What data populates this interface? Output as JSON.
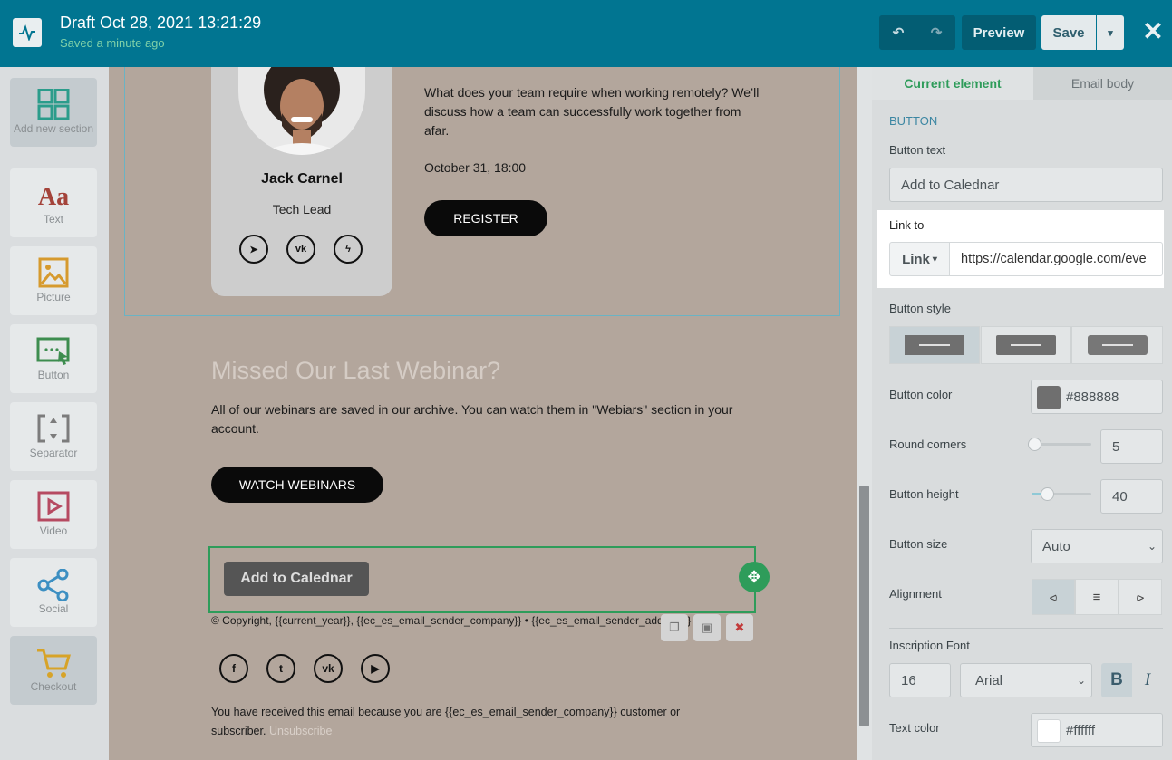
{
  "header": {
    "title": "Draft Oct 28, 2021 13:21:29",
    "subtitle": "Saved a minute ago",
    "undo_icon": "↶",
    "redo_icon": "↷",
    "preview_label": "Preview",
    "save_label": "Save",
    "save_caret": "▾",
    "close_icon": "✕"
  },
  "toolbar": {
    "items": [
      {
        "label": "Add new section",
        "icon": "grid-icon"
      },
      {
        "label": "Text",
        "icon": "text-icon"
      },
      {
        "label": "Picture",
        "icon": "picture-icon"
      },
      {
        "label": "Button",
        "icon": "button-icon"
      },
      {
        "label": "Separator",
        "icon": "separator-icon"
      },
      {
        "label": "Video",
        "icon": "video-icon"
      },
      {
        "label": "Social",
        "icon": "social-icon"
      },
      {
        "label": "Checkout",
        "icon": "cart-icon"
      }
    ]
  },
  "canvas": {
    "speaker": {
      "name": "Jack Carnel",
      "role": "Tech Lead",
      "socials": [
        "telegram-icon",
        "vk-icon",
        "messenger-icon"
      ],
      "social_glyphs": [
        "➤",
        "vk",
        "ϟ"
      ]
    },
    "event": {
      "description": "What does your team require when working remotely? We’ll discuss how a team can successfully work together from afar.",
      "date": "October 31, 18:00",
      "register_label": "REGISTER"
    },
    "missed": {
      "heading": "Missed Our Last Webinar?",
      "text": "All of our webinars are saved in our archive. You can watch them in \"Webiars\" section in your account.",
      "button_label": "WATCH WEBINARS"
    },
    "selected_button_label": "Add to Calednar",
    "move_icon": "✥",
    "copyright": "© Copyright, {{current_year}}, {{ec_es_email_sender_company}} • {{ec_es_email_sender_address}}",
    "actions": {
      "copy_glyph": "❐",
      "save_glyph": "▣",
      "delete_glyph": "✖"
    },
    "footer_socials": [
      "facebook-icon",
      "twitter-icon",
      "vk-icon",
      "youtube-icon"
    ],
    "footer_social_glyphs": [
      "f",
      "t",
      "vk",
      "▶"
    ],
    "received_text": "You have received this email because you are {{ec_es_email_sender_company}} customer or subscriber.",
    "unsubscribe_label": "Unsubscribe"
  },
  "panel": {
    "tabs": {
      "current": "Current element",
      "body": "Email body"
    },
    "section_title": "BUTTON",
    "button_text_label": "Button text",
    "button_text_value": "Add to Calednar",
    "link_to_label": "Link to",
    "link_type": "Link",
    "link_caret": "▾",
    "link_url": "https://calendar.google.com/eve",
    "button_style_label": "Button style",
    "button_color_label": "Button color",
    "button_color_value": "#888888",
    "round_corners_label": "Round corners",
    "round_corners_value": "5",
    "round_corners_level": 0.05,
    "button_height_label": "Button height",
    "button_height_value": "40",
    "button_height_level": 0.25,
    "button_size_label": "Button size",
    "button_size_value": "Auto",
    "alignment_label": "Alignment",
    "alignment_selected": "left",
    "alignment_icons": [
      "align-left-icon",
      "align-center-icon",
      "align-right-icon"
    ],
    "alignment_glyphs": [
      "⪦",
      "≡",
      "⪧"
    ],
    "inscription_font_label": "Inscription Font",
    "font_size_value": "16",
    "font_family_value": "Arial",
    "bold_label": "B",
    "italic_label": "I",
    "text_color_label": "Text color",
    "text_color_value": "#ffffff"
  },
  "colors": {
    "header_bg": "#017591",
    "accent_green": "#2e9c5a",
    "canvas_bg": "#b3a69c",
    "selected_button_bg": "#555555"
  }
}
